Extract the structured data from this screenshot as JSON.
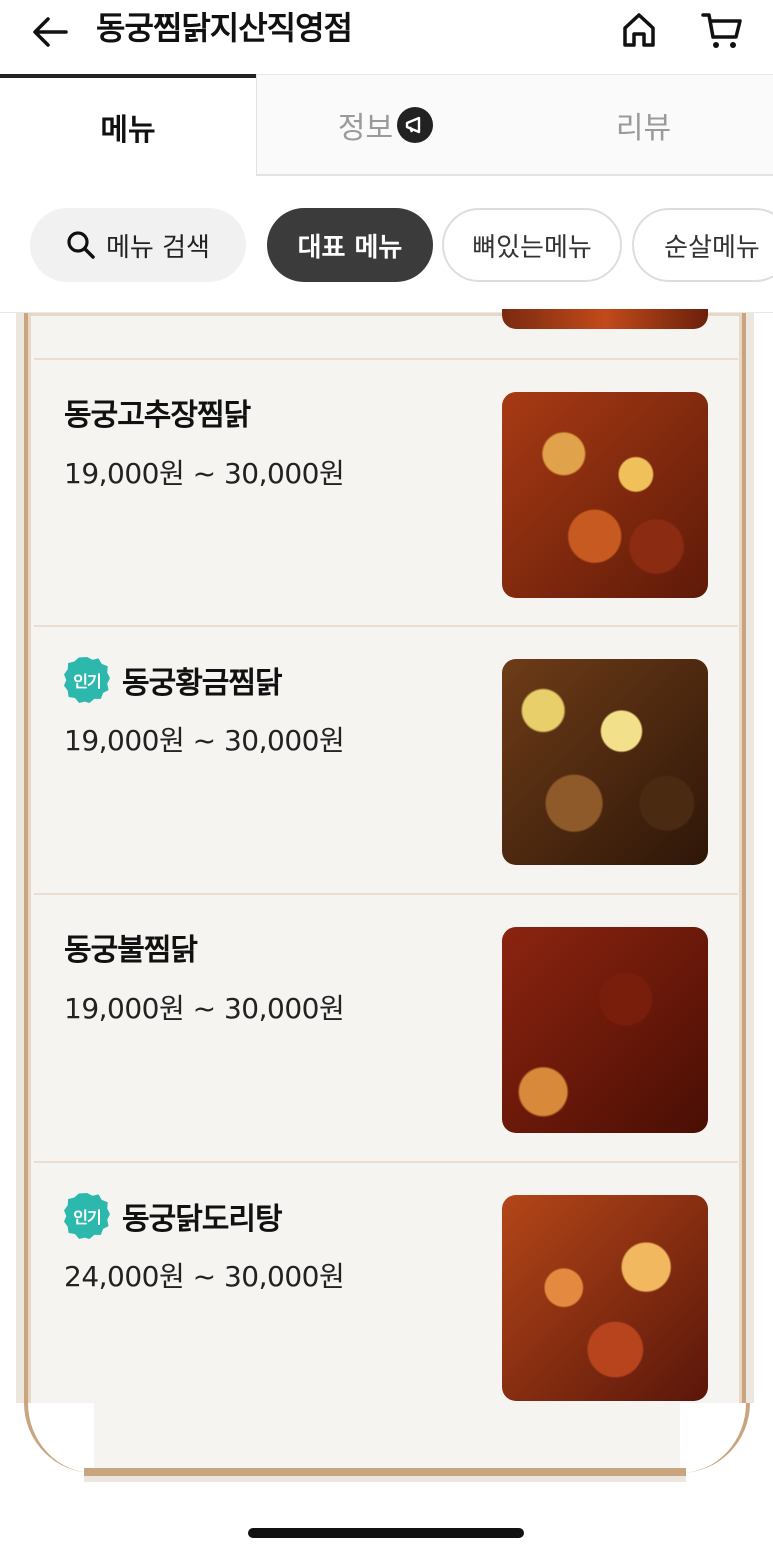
{
  "header": {
    "title": "동궁찜닭지산직영점",
    "back_icon": "arrow-left-icon",
    "home_icon": "home-icon",
    "cart_icon": "cart-icon"
  },
  "tabs": [
    {
      "label": "메뉴",
      "active": true
    },
    {
      "label": "정보",
      "active": false,
      "icon": "megaphone-icon"
    },
    {
      "label": "리뷰",
      "active": false
    }
  ],
  "chips": {
    "search_label": "메뉴 검색",
    "items": [
      "대표 메뉴",
      "뼈있는메뉴",
      "순살메뉴"
    ]
  },
  "menu_items": [
    {
      "name": "동궁고추장찜닭",
      "price": "19,000원 ~ 30,000원",
      "popular": false
    },
    {
      "name": "동궁황금찜닭",
      "price": "19,000원 ~ 30,000원",
      "popular": true
    },
    {
      "name": "동궁불찜닭",
      "price": "19,000원 ~ 30,000원",
      "popular": false
    },
    {
      "name": "동궁닭도리탕",
      "price": "24,000원 ~ 30,000원",
      "popular": true
    }
  ],
  "badge_label": "인기",
  "colors": {
    "accent": "#3b3b3b",
    "badge": "#2cb8ad",
    "frame": "#c9a57f"
  }
}
